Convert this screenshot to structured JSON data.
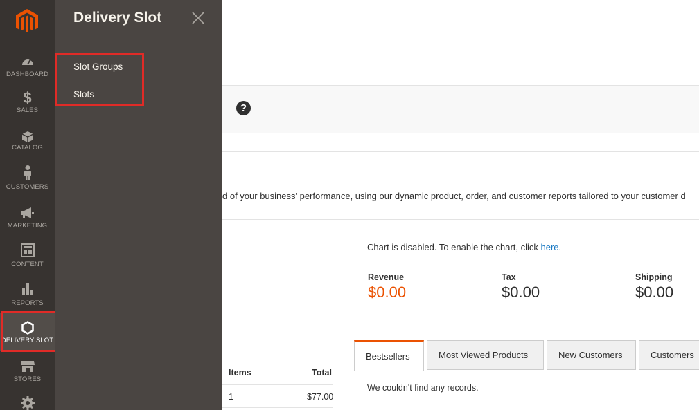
{
  "nav": {
    "items": [
      {
        "label": "DASHBOARD",
        "icon": "dashboard-icon"
      },
      {
        "label": "SALES",
        "icon": "dollar-icon"
      },
      {
        "label": "CATALOG",
        "icon": "box-icon"
      },
      {
        "label": "CUSTOMERS",
        "icon": "person-icon"
      },
      {
        "label": "MARKETING",
        "icon": "megaphone-icon"
      },
      {
        "label": "CONTENT",
        "icon": "layout-icon"
      },
      {
        "label": "REPORTS",
        "icon": "bar-chart-icon"
      },
      {
        "label": "DELIVERY SLOT",
        "icon": "hexagon-icon"
      },
      {
        "label": "STORES",
        "icon": "store-icon"
      },
      {
        "label": "",
        "icon": "gear-icon"
      }
    ],
    "active": "DELIVERY SLOT"
  },
  "flyout": {
    "title": "Delivery Slot",
    "links": [
      "Slot Groups",
      "Slots"
    ]
  },
  "main": {
    "intro_text": "d of your business' performance, using our dynamic product, order, and customer reports tailored to your customer d",
    "chart_message": "Chart is disabled. To enable the chart, click ",
    "chart_link": "here",
    "chart_message_end": ".",
    "metrics": [
      {
        "label": "Revenue",
        "value": "$0.00"
      },
      {
        "label": "Tax",
        "value": "$0.00"
      },
      {
        "label": "Shipping",
        "value": "$0.00"
      }
    ],
    "table": {
      "headers": [
        "Items",
        "Total"
      ],
      "rows": [
        [
          "1",
          "$77.00"
        ]
      ]
    },
    "tabs": [
      "Bestsellers",
      "Most Viewed Products",
      "New Customers",
      "Customers"
    ],
    "no_records": "We couldn't find any records."
  },
  "colors": {
    "nav_bg": "#373330",
    "flyout_bg": "#4a4542",
    "accent": "#eb5202",
    "highlight": "#e02b27",
    "link": "#1979c3"
  }
}
